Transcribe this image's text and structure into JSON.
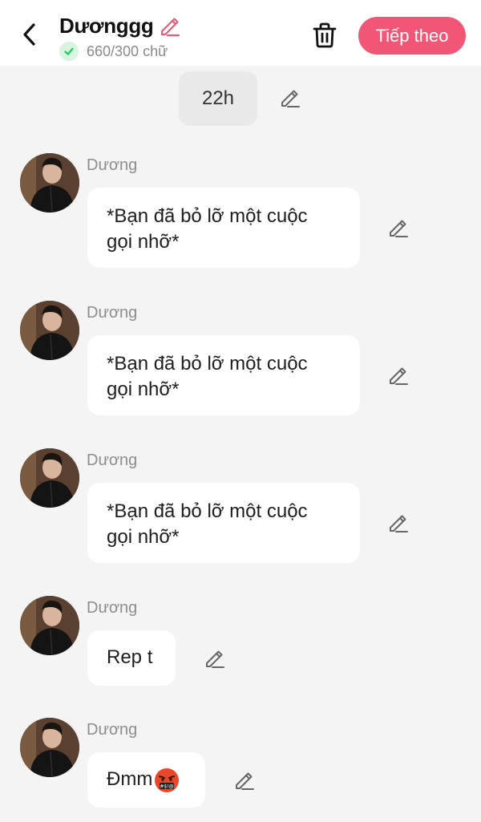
{
  "header": {
    "title": "Dươnggg",
    "word_count": "660/300 chữ",
    "next_button": "Tiếp theo"
  },
  "time_chip": "22h",
  "messages": [
    {
      "sender": "Dương",
      "text_line1": "*Bạn đã bỏ lỡ một cuộc",
      "text_line2": "gọi nhỡ*"
    },
    {
      "sender": "Dương",
      "text_line1": "*Bạn đã bỏ lỡ một cuộc",
      "text_line2": "gọi nhỡ*"
    },
    {
      "sender": "Dương",
      "text_line1": "*Bạn đã bỏ lỡ một cuộc",
      "text_line2": "gọi nhỡ*"
    },
    {
      "sender": "Dương",
      "text": "Rep t"
    },
    {
      "sender": "Dương",
      "text": "Đmm"
    }
  ],
  "colors": {
    "accent": "#f25676",
    "check_bg": "#d9f5e1",
    "check_mark": "#22c55e",
    "background": "#f4f4f4"
  },
  "icons": {
    "back": "chevron-left-icon",
    "title_edit": "pencil-icon",
    "verified": "check-icon",
    "delete": "trash-icon",
    "message_edit": "pencil-icon",
    "emoji": "cursing-face-emoji"
  }
}
